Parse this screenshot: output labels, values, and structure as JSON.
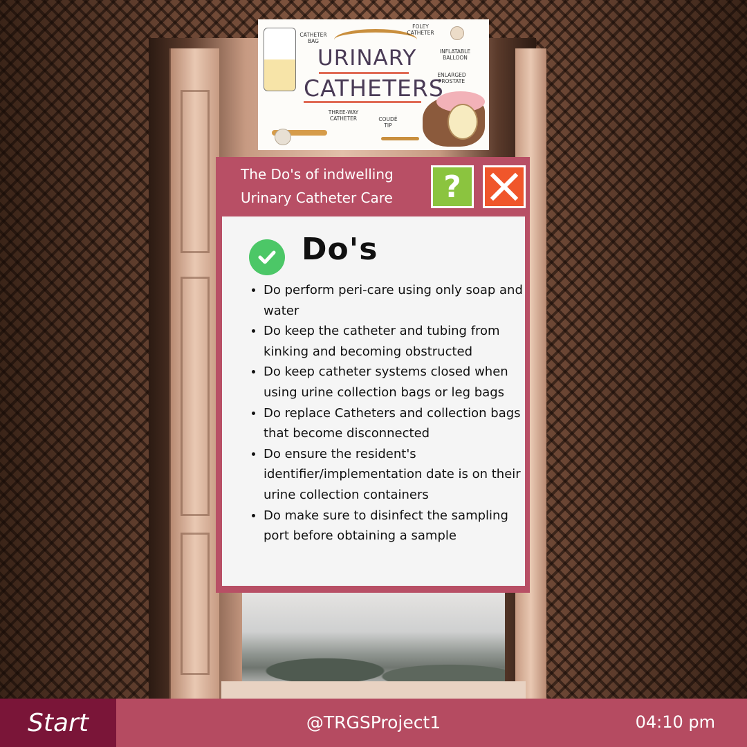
{
  "illustration": {
    "title_line1": "URINARY",
    "title_line2": "CATHETERS",
    "labels": {
      "catheter_bag": "CATHETER BAG",
      "foley_catheter": "FOLEY CATHETER",
      "inflatable_balloon": "INFLATABLE BALLOON",
      "enlarged_prostate": "ENLARGED PROSTATE",
      "three_way_catheter": "THREE-WAY CATHETER",
      "coude_tip": "COUDÉ TIP"
    }
  },
  "window": {
    "title_line1": "The Do's of indwelling",
    "title_line2": "Urinary Catheter Care",
    "help_label": "?",
    "content": {
      "heading": "Do's",
      "items": [
        "Do perform peri-care using only soap and water",
        "Do keep the catheter and tubing from kinking and becoming obstructed",
        "Do keep catheter systems closed when using urine collection bags or leg bags",
        "Do replace Catheters and collection bags that become disconnected",
        "Do ensure the resident's identifier/implementation date is on their urine collection containers",
        "Do make sure to disinfect the sampling port before obtaining a sample"
      ]
    }
  },
  "taskbar": {
    "start_label": "Start",
    "handle": "@TRGSProject1",
    "clock": "04:10 pm"
  },
  "colors": {
    "window": "#b84f65",
    "taskbar": "#b54b61",
    "start": "#7a1538",
    "help": "#8bc43f",
    "close": "#f0562b",
    "check": "#4cc767"
  }
}
